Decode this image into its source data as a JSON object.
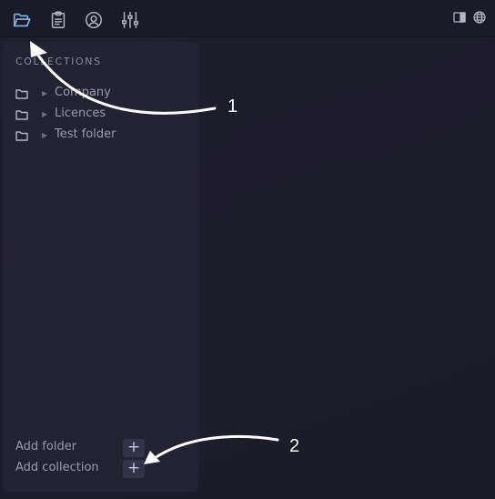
{
  "toolbar": {
    "icons": [
      "folder-open-icon",
      "clipboard-icon",
      "user-circle-icon",
      "sliders-icon"
    ],
    "right_icons": [
      "sidebar-toggle-icon",
      "globe-icon"
    ],
    "accent": "#7cb8f0",
    "icon_color": "#b4b4c4"
  },
  "sidebar": {
    "title": "COLLECTIONS",
    "items": [
      {
        "label": "Company"
      },
      {
        "label": "Licences"
      },
      {
        "label": "Test folder"
      }
    ],
    "actions": {
      "add_folder": "Add folder",
      "add_collection": "Add collection",
      "plus": "+"
    }
  },
  "annotations": {
    "one": "1",
    "two": "2"
  }
}
